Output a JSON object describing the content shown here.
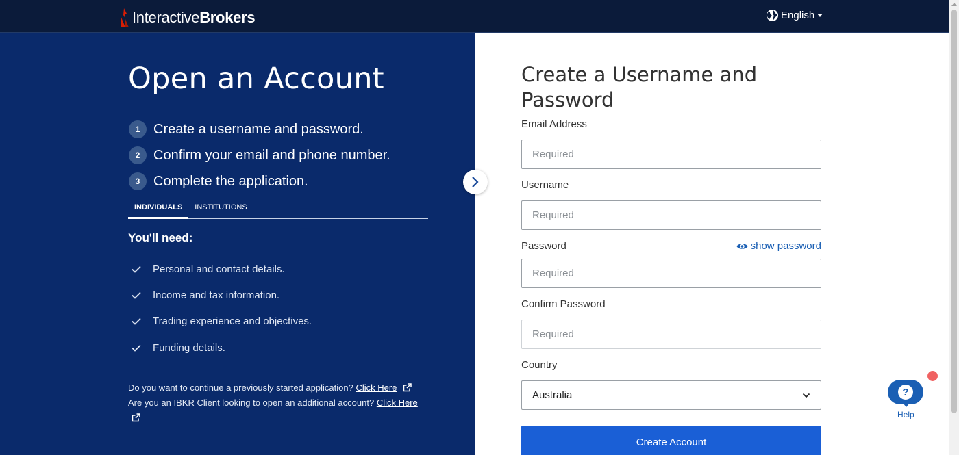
{
  "header": {
    "logo_regular": "Interactive",
    "logo_bold": "Brokers",
    "language": "English"
  },
  "left": {
    "title": "Open an Account",
    "steps": [
      {
        "num": "1",
        "text": "Create a username and password."
      },
      {
        "num": "2",
        "text": "Confirm your email and phone number."
      },
      {
        "num": "3",
        "text": "Complete the application."
      }
    ],
    "tabs": [
      "INDIVIDUALS",
      "INSTITUTIONS"
    ],
    "need_heading": "You'll need:",
    "needs": [
      "Personal and contact details.",
      "Income and tax information.",
      "Trading experience and objectives.",
      "Funding details."
    ],
    "footer": {
      "line1": "Do you want to continue a previously started application?",
      "line2": "Are you an IBKR Client looking to open an additional account?",
      "link": "Click Here"
    }
  },
  "form": {
    "title": "Create a Username and Password",
    "email_label": "Email Address",
    "username_label": "Username",
    "password_label": "Password",
    "show_password": "show password",
    "confirm_label": "Confirm Password",
    "country_label": "Country",
    "placeholder": "Required",
    "country_value": "Australia",
    "submit": "Create Account"
  },
  "help": {
    "label": "Help",
    "glyph": "?"
  },
  "colors": {
    "header_bg": "#0b1b3a",
    "panel_bg": "#0a2a6b",
    "accent": "#1a5fd6",
    "link_blue": "#1a5fb4"
  }
}
